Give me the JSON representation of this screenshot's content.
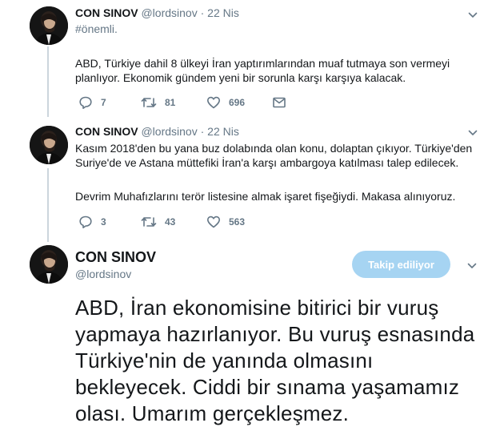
{
  "tweets": [
    {
      "author_name": "CON SINOV",
      "handle": "@lordsinov",
      "separator": "·",
      "time": "22 Nis",
      "hashtag": "#önemli.",
      "text": "ABD, Türkiye dahil 8 ülkeyi İran yaptırımlarından muaf tutmaya son vermeyi planlıyor. Ekonomik gündem yeni bir sorunla karşı karşıya kalacak.",
      "replies": "7",
      "retweets": "81",
      "likes": "696"
    },
    {
      "author_name": "CON SINOV",
      "handle": "@lordsinov",
      "separator": "·",
      "time": "22 Nis",
      "text_p1": "Kasım 2018'den bu yana buz dolabında olan konu, dolaptan çıkıyor. Türkiye'den Suriye'de ve Astana müttefiki İran'a karşı ambargoya katılması talep edilecek.",
      "text_p2": "Devrim Muhafızlarını terör listesine almak işaret fişeğiydi. Makasa alınıyoruz.",
      "replies": "3",
      "retweets": "43",
      "likes": "563"
    }
  ],
  "main_tweet": {
    "author_name": "CON SINOV",
    "handle": "@lordsinov",
    "follow_label": "Takip ediliyor",
    "text": "ABD, İran ekonomisine bitirici bir vuruş yapmaya hazırlanıyor. Bu vuruş esnasında Türkiye'nin de yanında olmasını bekleyecek. Ciddi bir sınama yaşamamız olası. Umarım gerçekleşmez."
  },
  "icons": {
    "reply": "reply-icon",
    "retweet": "retweet-icon",
    "like": "heart-icon",
    "dm": "envelope-icon",
    "caret": "chevron-down-icon"
  },
  "colors": {
    "text": "#14171a",
    "secondary": "#657786",
    "thread_line": "#ccd6dd",
    "follow_button": "#a6d4f2"
  }
}
